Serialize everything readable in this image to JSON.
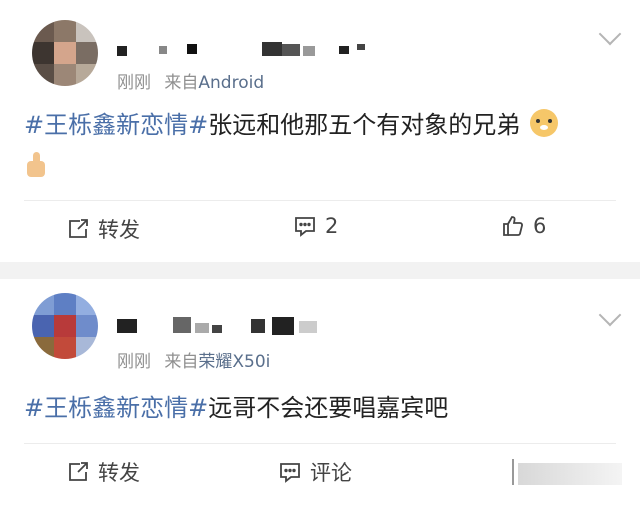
{
  "posts": [
    {
      "meta": {
        "time": "刚刚",
        "from_prefix": "来自",
        "source": "Android"
      },
      "content": {
        "topic": "#王栎鑫新恋情#",
        "text": "张远和他那五个有对象的兄弟",
        "emojis": [
          "doge-emoji",
          "thumbs-up-emoji"
        ]
      },
      "actions": {
        "share_label": "转发",
        "comment_count": "2",
        "like_count": "6"
      }
    },
    {
      "meta": {
        "time": "刚刚",
        "from_prefix": "来自",
        "source": "荣耀X50i"
      },
      "content": {
        "topic": "#王栎鑫新恋情#",
        "text": "远哥不会还要唱嘉宾吧"
      },
      "actions": {
        "share_label": "转发",
        "comment_label": "评论"
      }
    }
  ],
  "colors": {
    "topic": "#4a6fa8",
    "meta": "#909090",
    "background": "#f2f2f2"
  }
}
